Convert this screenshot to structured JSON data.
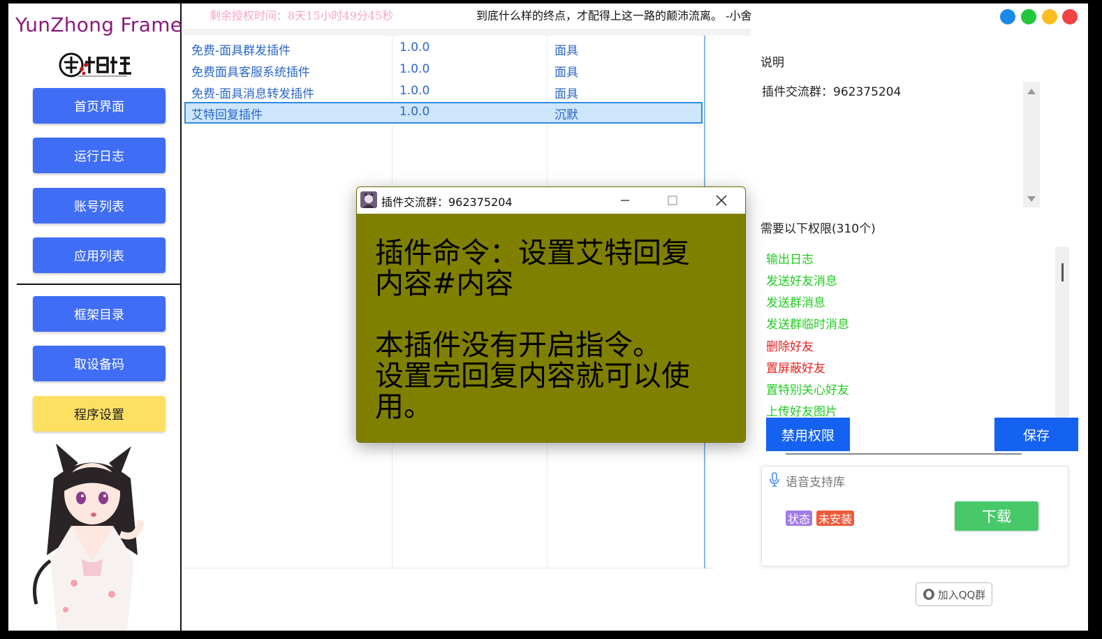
{
  "sidebar": {
    "brand": "YunZhong Frame",
    "nav": [
      "首页界面",
      "运行日志",
      "账号列表",
      "应用列表"
    ],
    "nav2": [
      "框架目录",
      "取设备码",
      "程序设置"
    ]
  },
  "header": {
    "license": "剩余授权时间：8天15小时49分45秒",
    "motto": "到底什么样的终点，才配得上这一路的颠沛流离。  -小舍",
    "dots": [
      "#1a8ae8",
      "#22c83a",
      "#fbbd1f",
      "#f04343"
    ]
  },
  "plugins": [
    {
      "name": "免费-面具群发插件",
      "version": "1.0.0",
      "author": "面具"
    },
    {
      "name": "免费面具客服系统插件",
      "version": "1.0.0",
      "author": "面具"
    },
    {
      "name": "免费-面具消息转发插件",
      "version": "1.0.0",
      "author": "面具"
    },
    {
      "name": "艾特回复插件",
      "version": "1.0.0",
      "author": "沉默"
    }
  ],
  "right": {
    "desc_label": "说明",
    "desc_text": "插件交流群：962375204",
    "perm_label": "需要以下权限(310个)",
    "permissions": [
      {
        "label": "输出日志",
        "color": "#22cc22"
      },
      {
        "label": "发送好友消息",
        "color": "#22cc22"
      },
      {
        "label": "发送群消息",
        "color": "#22cc22"
      },
      {
        "label": "发送群临时消息",
        "color": "#22cc22"
      },
      {
        "label": "删除好友",
        "color": "#e82020"
      },
      {
        "label": "置屏蔽好友",
        "color": "#e82020"
      },
      {
        "label": "置特别关心好友",
        "color": "#22cc22"
      },
      {
        "label": "上传好友图片",
        "color": "#22cc22"
      }
    ],
    "disable_btn": "禁用权限",
    "save_btn": "保存"
  },
  "voice": {
    "title": "语音支持库",
    "status_label": "状态",
    "status_value": "未安装",
    "download": "下载",
    "qq": "加入QQ群"
  },
  "dialog": {
    "title": "插件交流群：962375204",
    "line1": "插件命令：设置艾特回复",
    "line2": "内容#内容",
    "line3": "本插件没有开启指令。",
    "line4": "设置完回复内容就可以使",
    "line5": "用。"
  }
}
